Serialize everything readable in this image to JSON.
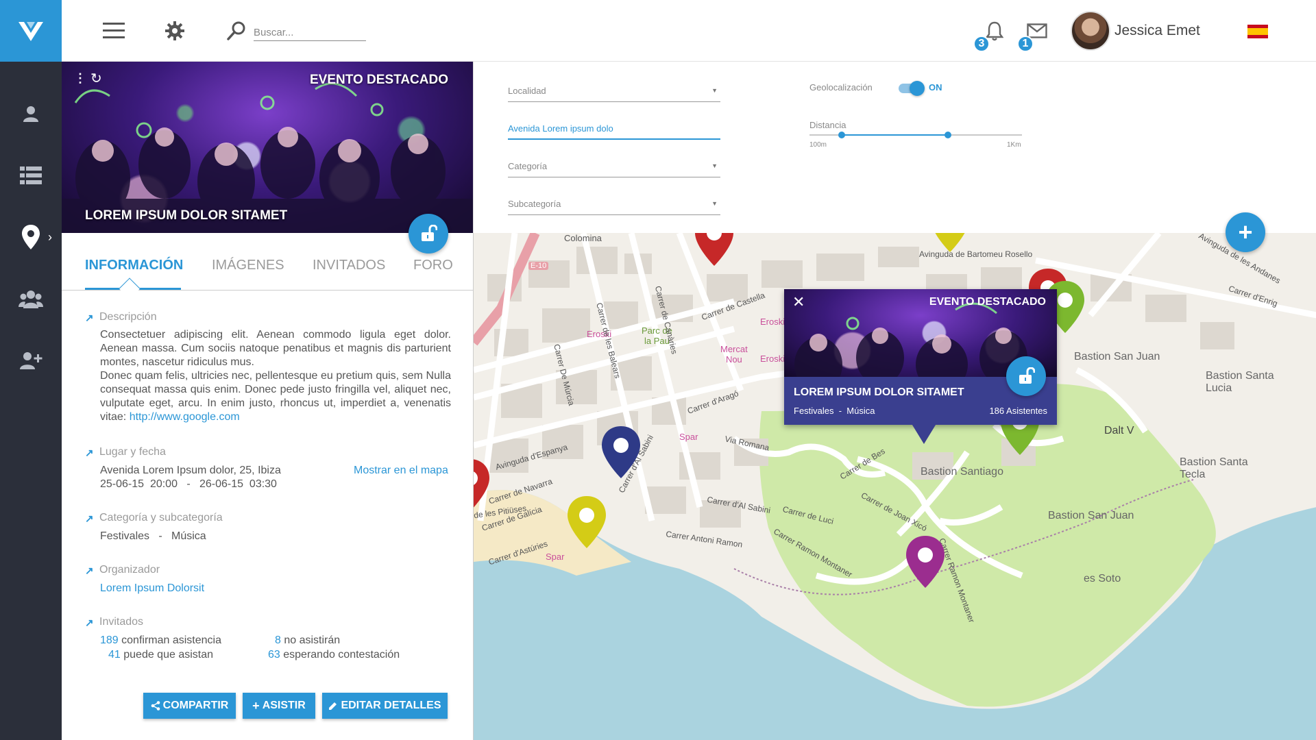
{
  "app": {
    "logo": "V"
  },
  "topbar": {
    "search_placeholder": "Buscar...",
    "notifications_count": "3",
    "messages_count": "1",
    "user_name": "Jessica Emet",
    "language_flag": "spain-flag-icon"
  },
  "sidebar": {
    "items": [
      {
        "icon": "user-icon"
      },
      {
        "icon": "list-icon"
      },
      {
        "icon": "map-pin-icon",
        "active": true
      },
      {
        "icon": "group-icon"
      },
      {
        "icon": "add-user-icon"
      }
    ],
    "chevron": "›"
  },
  "hero": {
    "tag": "EVENTO DESTACADO",
    "title": "LOREM IPSUM DOLOR SITAMET",
    "menu": "⋮",
    "refresh": "↻"
  },
  "tabs": [
    {
      "label": "INFORMACIÓN",
      "active": true
    },
    {
      "label": "IMÁGENES"
    },
    {
      "label": "INVITADOS"
    },
    {
      "label": "FORO"
    }
  ],
  "info": {
    "description": {
      "label": "Descripción",
      "p1": "Consectetuer adipiscing elit. Aenean commodo ligula eget dolor. Aenean massa. Cum sociis natoque penatibus et magnis dis parturient montes, nascetur ridiculus mus.",
      "p2": "Donec quam felis, ultricies nec, pellentesque eu pretium quis, sem Nulla consequat massa quis enim. Donec pede justo fringilla vel, aliquet nec, vulputate eget, arcu. In enim justo, rhoncus ut, imperdiet a, venenatis vitae:",
      "link": "http://www.google.com"
    },
    "place": {
      "label": "Lugar y fecha",
      "address": "Avenida Lorem Ipsum dolor, 25, Ibiza",
      "dates": "25-06-15  20:00   -   26-06-15  03:30",
      "map_link": "Mostrar en el mapa"
    },
    "category": {
      "label": "Categoría y subcategoría",
      "value": "Festivales   -   Música"
    },
    "organizer": {
      "label": "Organizador",
      "value": "Lorem Ipsum Dolorsit"
    },
    "guests": {
      "label": "Invitados",
      "confirm_n": "189",
      "confirm_t": " confirman asistencia",
      "maybe_n": "41",
      "maybe_t": " puede que asistan",
      "no_n": "8",
      "no_t": " no asistirán",
      "wait_n": "63",
      "wait_t": " esperando contestación"
    },
    "buttons": {
      "share": "COMPARTIR",
      "attend": "ASISTIR",
      "edit": "EDITAR DETALLES"
    }
  },
  "filters": {
    "localidad": "Localidad",
    "address_value": "Avenida Lorem ipsum dolo",
    "categoria": "Categoría",
    "subcategoria": "Subcategoría",
    "geo_label": "Geolocalización",
    "geo_state": "ON",
    "distance_label": "Distancia",
    "distance_min": "100m",
    "distance_max": "1Km",
    "distance_range": [
      0.15,
      0.65
    ]
  },
  "map": {
    "labels": {
      "colomina": "Colomina",
      "e10": "E-10",
      "eroski1": "Eroski",
      "eroski2": "Eroski",
      "eroski3": "Eroski",
      "parc": "Parc de\nla Pau",
      "mercat": "Mercat\nNou",
      "spar1": "Spar",
      "spar2": "Spar",
      "bastion_sj1": "Bastion San Juan",
      "bastion_sl": "Bastion Santa\nLucia",
      "bastion_santiago": "Bastion Santiago",
      "bastion_sj2": "Bastion San Juan",
      "bastion_st": "Bastion Santa\nTecla",
      "dalt_vila": "Dalt V",
      "es_soto": "es Soto",
      "av_bartomeu": "Avinguda de Bartomeu Rosello",
      "av_espanya": "Avinguda d'Espanya",
      "via_romana": "Via Romana",
      "carrer_navarra": "Carrer de Navarra",
      "carrer_galicia": "Carrer de Galícia",
      "carrer_asturies": "Carrer d'Astúries",
      "carrer_arago": "Carrer d'Aragó",
      "carrer_castella": "Carrer de Castella",
      "carrer_balears": "Carrer de les Balears",
      "carrer_murcia": "Carrer De Múrcia",
      "carrer_canaries": "Carrer de Canàries",
      "carrer_sabini": "Carrer d'Al Sabini",
      "carrer_sabini2": "Carrer d'Al Sabini",
      "carrer_ramon": "Carrer Antoni Ramon",
      "carrer_montaner": "Carrer Ramon Montaner",
      "carrer_montaner2": "Carrer Ramon Montaner",
      "carrer_bes": "Carrer de Bes",
      "carrer_xico": "Carrer de Joan Xicó",
      "carrer_luci": "Carrer de Luci",
      "av_andanes": "Avinguda de les Andanes",
      "carrer_enrig": "Carrer d'Enrig",
      "pitiuses": "de les Pitiüses"
    },
    "pins": [
      {
        "color": "#c62828"
      },
      {
        "color": "#c62828"
      },
      {
        "color": "#7cb82f"
      },
      {
        "color": "#7cb82f"
      },
      {
        "color": "#2e3a87"
      },
      {
        "color": "#d4cc16"
      },
      {
        "color": "#9b2d8f"
      },
      {
        "color": "#c62828"
      },
      {
        "color": "#d4cc16"
      }
    ],
    "popup": {
      "tag": "EVENTO DESTACADO",
      "title": "LOREM IPSUM DOLOR SITAMET",
      "category": "Festivales  -  Música",
      "attendees": "186 Asistentes",
      "close": "✕"
    },
    "add_button": "+"
  },
  "colors": {
    "accent": "#2b96d6",
    "rail": "#2b2f3a",
    "popup": "#3a3f8f"
  }
}
